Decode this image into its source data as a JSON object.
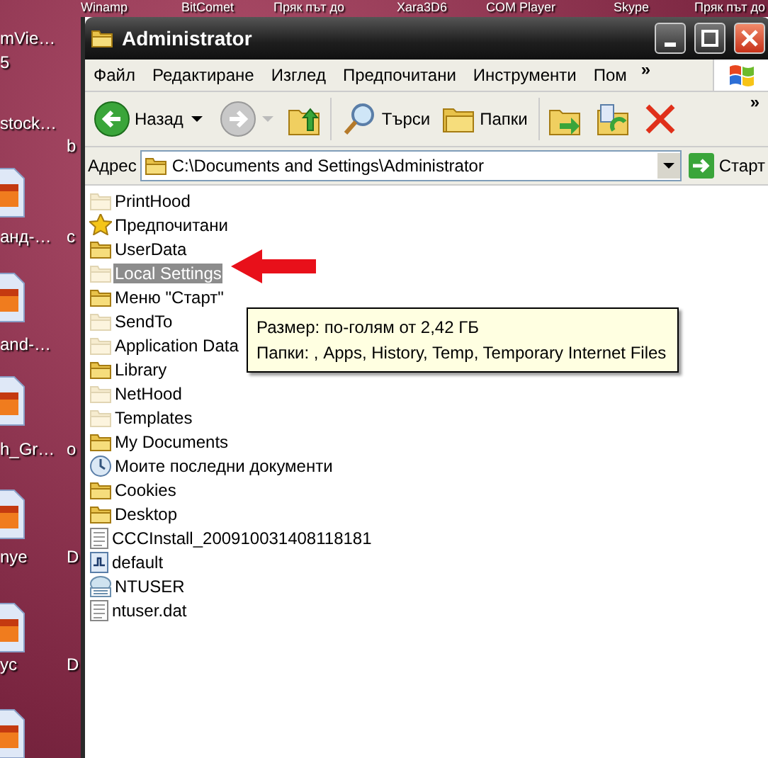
{
  "desktop": {
    "top_labels": [
      "Winamp",
      "BitComet",
      "Пряк път до",
      "Xara3D6",
      "COM Player",
      "Skype",
      "Пряк път до"
    ],
    "left_labels": [
      "mVie…",
      "5",
      "stock…",
      "анд-…",
      "and-…",
      "h_Gr…",
      "nye",
      "yc"
    ],
    "side_labels": [
      "b",
      "c",
      "o",
      "D",
      "D"
    ]
  },
  "window": {
    "title": "Administrator"
  },
  "menu": [
    "Файл",
    "Редактиране",
    "Изглед",
    "Предпочитани",
    "Инструменти",
    "Пом"
  ],
  "menu_more": "»",
  "toolbar": {
    "back": "Назад",
    "search": "Търси",
    "folders": "Папки",
    "more": "»"
  },
  "address": {
    "label": "Адрес",
    "value": "C:\\Documents and Settings\\Administrator",
    "go": "Старт"
  },
  "files": [
    {
      "name": "PrintHood",
      "kind": "folder",
      "hidden": true,
      "selected": false
    },
    {
      "name": "Предпочитани",
      "kind": "favorites",
      "hidden": false,
      "selected": false
    },
    {
      "name": "UserData",
      "kind": "folder",
      "hidden": false,
      "selected": false
    },
    {
      "name": "Local Settings",
      "kind": "folder",
      "hidden": true,
      "selected": true
    },
    {
      "name": "Меню \"Старт\"",
      "kind": "folder",
      "hidden": false,
      "selected": false
    },
    {
      "name": "SendTo",
      "kind": "folder",
      "hidden": true,
      "selected": false
    },
    {
      "name": "Application Data",
      "kind": "folder",
      "hidden": true,
      "selected": false
    },
    {
      "name": "Library",
      "kind": "folder",
      "hidden": false,
      "selected": false
    },
    {
      "name": "NetHood",
      "kind": "folder",
      "hidden": true,
      "selected": false
    },
    {
      "name": "Templates",
      "kind": "folder",
      "hidden": true,
      "selected": false
    },
    {
      "name": "My Documents",
      "kind": "folder",
      "hidden": false,
      "selected": false
    },
    {
      "name": "Моите последни документи",
      "kind": "recent",
      "hidden": false,
      "selected": false
    },
    {
      "name": "Cookies",
      "kind": "folder",
      "hidden": false,
      "selected": false
    },
    {
      "name": "Desktop",
      "kind": "folder",
      "hidden": false,
      "selected": false
    },
    {
      "name": "CCCInstall_200910031408118181",
      "kind": "text",
      "hidden": false,
      "selected": false
    },
    {
      "name": "default",
      "kind": "wave",
      "hidden": false,
      "selected": false
    },
    {
      "name": "NTUSER",
      "kind": "dat",
      "hidden": false,
      "selected": false
    },
    {
      "name": "ntuser.dat",
      "kind": "text",
      "hidden": false,
      "selected": false
    }
  ],
  "tooltip": {
    "lines": [
      "Размер: по-голям от 2,42 ГБ",
      "Папки: , Apps, History, Temp, Temporary Internet Files"
    ]
  }
}
